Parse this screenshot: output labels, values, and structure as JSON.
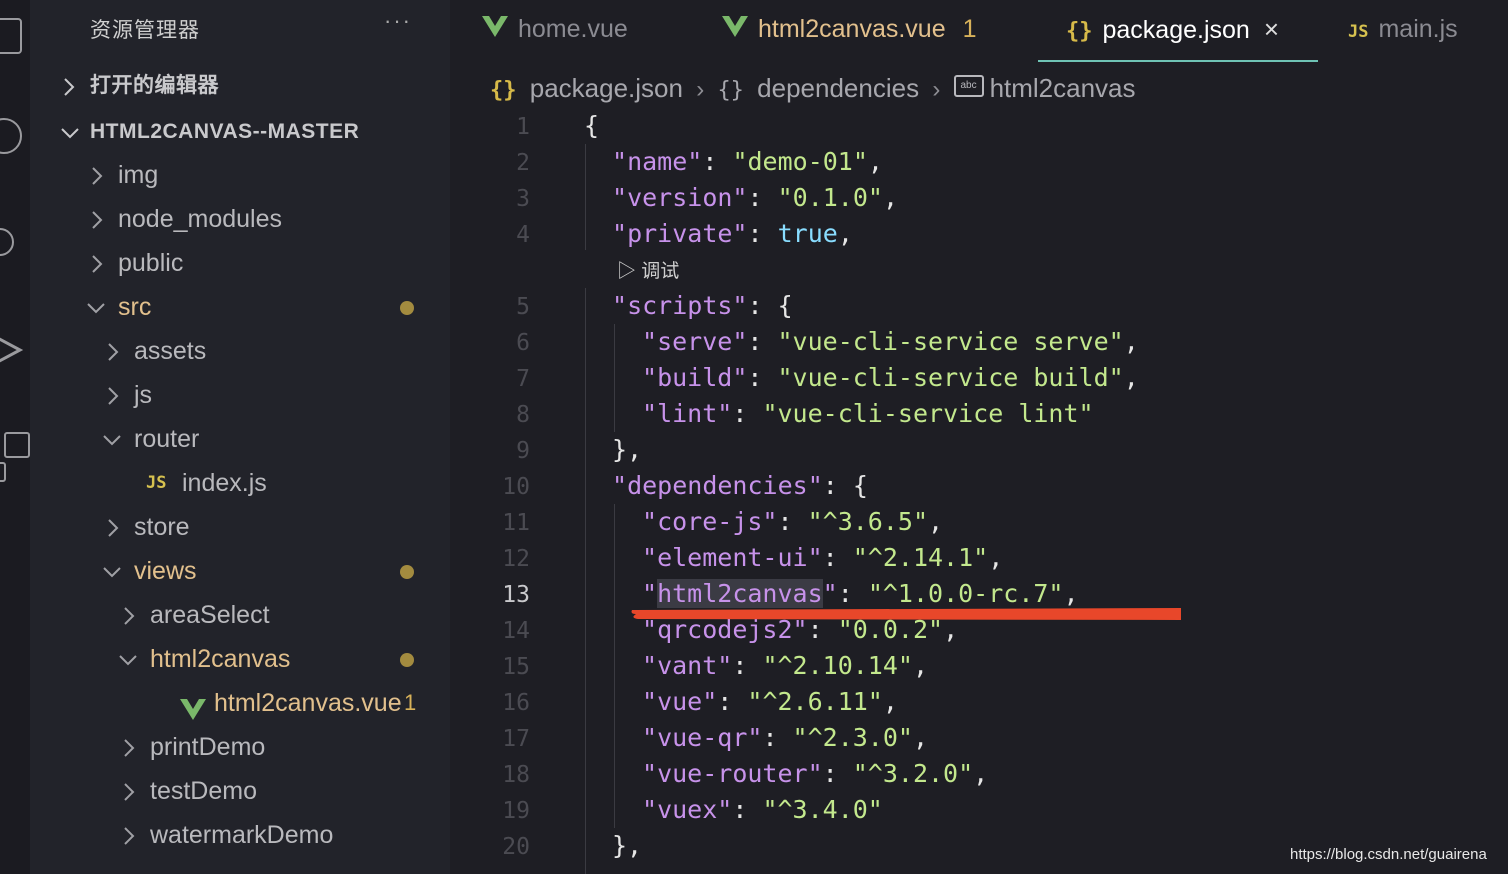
{
  "explorer": {
    "title": "资源管理器",
    "more": "···",
    "open_editors": "打开的编辑器",
    "project": "HTML2CANVAS--MASTER",
    "tree": [
      {
        "name": "img",
        "indent": 0,
        "expanded": false
      },
      {
        "name": "node_modules",
        "indent": 0,
        "expanded": false
      },
      {
        "name": "public",
        "indent": 0,
        "expanded": false
      },
      {
        "name": "src",
        "indent": 0,
        "expanded": true,
        "modified": true
      },
      {
        "name": "assets",
        "indent": 1,
        "expanded": false
      },
      {
        "name": "js",
        "indent": 1,
        "expanded": false
      },
      {
        "name": "router",
        "indent": 1,
        "expanded": true
      },
      {
        "name": "index.js",
        "indent": 2,
        "file": "js"
      },
      {
        "name": "store",
        "indent": 1,
        "expanded": false
      },
      {
        "name": "views",
        "indent": 1,
        "expanded": true,
        "modified": true
      },
      {
        "name": "areaSelect",
        "indent": 2,
        "expanded": false
      },
      {
        "name": "html2canvas",
        "indent": 2,
        "expanded": true,
        "modified": true
      },
      {
        "name": "html2canvas.vue",
        "indent": 3,
        "file": "vue",
        "badge": "1"
      },
      {
        "name": "printDemo",
        "indent": 2,
        "expanded": false
      },
      {
        "name": "testDemo",
        "indent": 2,
        "expanded": false
      },
      {
        "name": "watermarkDemo",
        "indent": 2,
        "expanded": false
      }
    ]
  },
  "tabs": [
    {
      "label": "home.vue",
      "icon": "vue-icon",
      "active": false
    },
    {
      "label": "html2canvas.vue",
      "icon": "vue-icon",
      "active": false,
      "modified": true,
      "badge": "1"
    },
    {
      "label": "package.json",
      "icon": "json-icon",
      "active": true,
      "close": "×"
    },
    {
      "label": "main.js",
      "icon": "js-icon",
      "active": false
    }
  ],
  "breadcrumb": {
    "file": "package.json",
    "section": "dependencies",
    "symbol": "html2canvas",
    "json_glyph": "{}",
    "abc_glyph": "abc"
  },
  "codelens": "调试",
  "code_lines": [
    {
      "n": "1",
      "text": "{"
    },
    {
      "n": "2",
      "key": "name",
      "val": "\"demo-01\"",
      "end": ","
    },
    {
      "n": "3",
      "key": "version",
      "val": "\"0.1.0\"",
      "end": ","
    },
    {
      "n": "4",
      "key": "private",
      "lit": "true",
      "end": ","
    },
    {
      "n": "5",
      "key": "scripts",
      "open": "{"
    },
    {
      "n": "6",
      "key": "serve",
      "val": "\"vue-cli-service serve\"",
      "end": ","
    },
    {
      "n": "7",
      "key": "build",
      "val": "\"vue-cli-service build\"",
      "end": ","
    },
    {
      "n": "8",
      "key": "lint",
      "val": "\"vue-cli-service lint\"",
      "end": ""
    },
    {
      "n": "9",
      "text": "},"
    },
    {
      "n": "10",
      "key": "dependencies",
      "open": "{"
    },
    {
      "n": "11",
      "key": "core-js",
      "val": "\"^3.6.5\"",
      "end": ","
    },
    {
      "n": "12",
      "key": "element-ui",
      "val": "\"^2.14.1\"",
      "end": ","
    },
    {
      "n": "13",
      "key": "html2canvas",
      "val": "\"^1.0.0-rc.7\"",
      "end": ",",
      "current": true
    },
    {
      "n": "14",
      "key": "qrcodejs2",
      "val": "\"0.0.2\"",
      "end": ","
    },
    {
      "n": "15",
      "key": "vant",
      "val": "\"^2.10.14\"",
      "end": ","
    },
    {
      "n": "16",
      "key": "vue",
      "val": "\"^2.6.11\"",
      "end": ","
    },
    {
      "n": "17",
      "key": "vue-qr",
      "val": "\"^2.3.0\"",
      "end": ","
    },
    {
      "n": "18",
      "key": "vue-router",
      "val": "\"^3.2.0\"",
      "end": ","
    },
    {
      "n": "19",
      "key": "vuex",
      "val": "\"^3.4.0\"",
      "end": ""
    },
    {
      "n": "20",
      "text": "},"
    }
  ],
  "colors": {
    "annotation": "#e8472a",
    "modified": "#e2c08d",
    "accent": "#6fc3b5"
  },
  "watermark": "https://blog.csdn.net/guairena"
}
